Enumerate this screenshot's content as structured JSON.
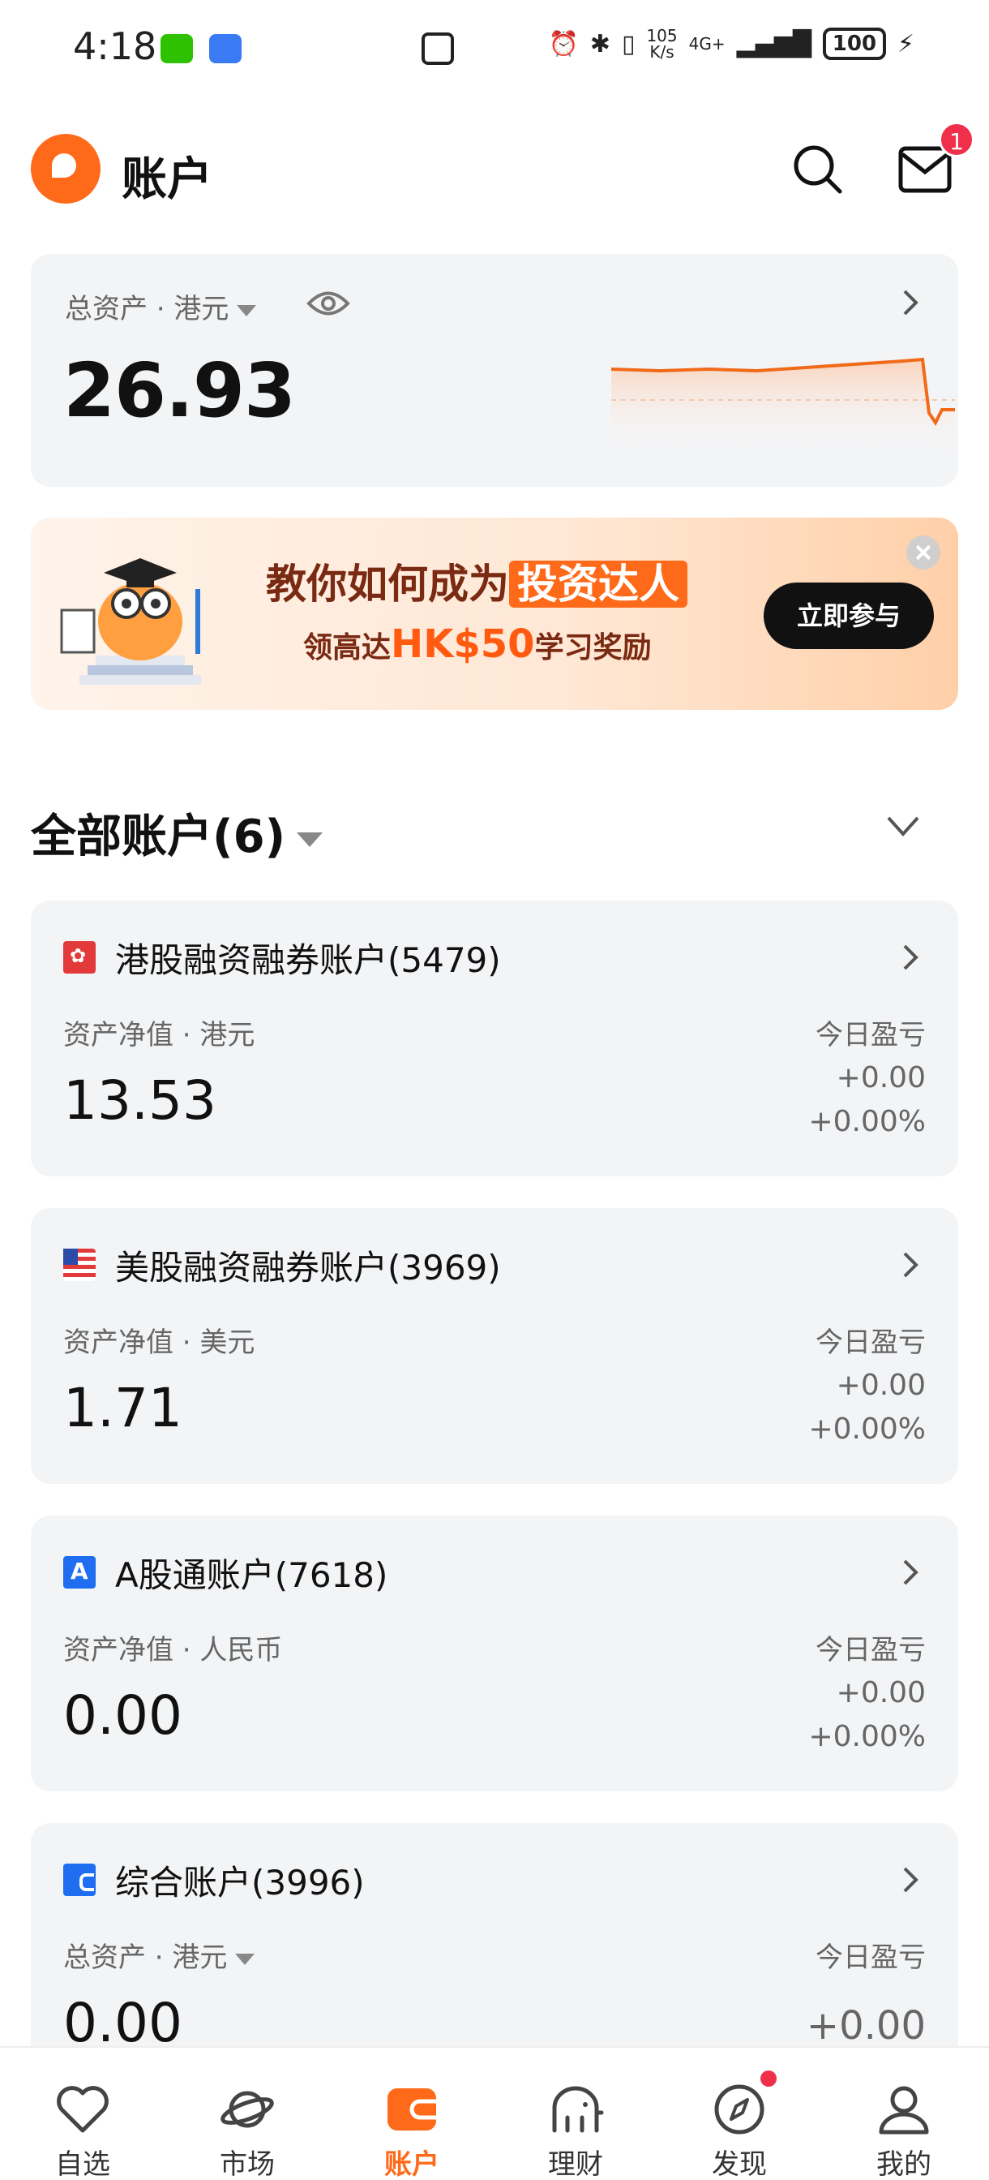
{
  "status_bar": {
    "time": "4:18",
    "speed_top": "105",
    "speed_bottom": "K/s",
    "network": "4G+",
    "battery": "100"
  },
  "header": {
    "title": "账户",
    "badge_count": "1"
  },
  "total_assets": {
    "label": "总资产 · 港元",
    "value": "26.93"
  },
  "banner": {
    "line1_prefix": "教你如何成为",
    "line1_highlight": "投资达人",
    "line2_prefix": "领高达",
    "line2_amount": "HK$50",
    "line2_suffix": "学习奖励",
    "cta": "立即参与"
  },
  "accounts_section": {
    "title": "全部账户(6)"
  },
  "accounts": [
    {
      "name": "港股融资融券账户(5479)",
      "sub": "资产净值 · 港元",
      "value": "13.53",
      "pl_label": "今日盈亏",
      "pl_amount": "+0.00",
      "pl_pct": "+0.00%"
    },
    {
      "name": "美股融资融券账户(3969)",
      "sub": "资产净值 · 美元",
      "value": "1.71",
      "pl_label": "今日盈亏",
      "pl_amount": "+0.00",
      "pl_pct": "+0.00%"
    },
    {
      "name": "A股通账户(7618)",
      "sub": "资产净值 · 人民币",
      "value": "0.00",
      "pl_label": "今日盈亏",
      "pl_amount": "+0.00",
      "pl_pct": "+0.00%"
    },
    {
      "name": "综合账户(3996)",
      "sub": "总资产 · 港元",
      "value": "0.00",
      "pl_label": "今日盈亏",
      "pl_amount": "+0.00"
    }
  ],
  "tabbar": {
    "items": [
      {
        "label": "自选",
        "icon": "heart-icon"
      },
      {
        "label": "市场",
        "icon": "planet-icon"
      },
      {
        "label": "账户",
        "icon": "wallet-icon"
      },
      {
        "label": "理财",
        "icon": "elephant-icon"
      },
      {
        "label": "发现",
        "icon": "compass-icon"
      },
      {
        "label": "我的",
        "icon": "person-icon"
      }
    ],
    "active": "账户"
  },
  "colors": {
    "accent": "#ff6a1a",
    "badge": "#f0304a",
    "card_bg": "#f3f4f6"
  }
}
